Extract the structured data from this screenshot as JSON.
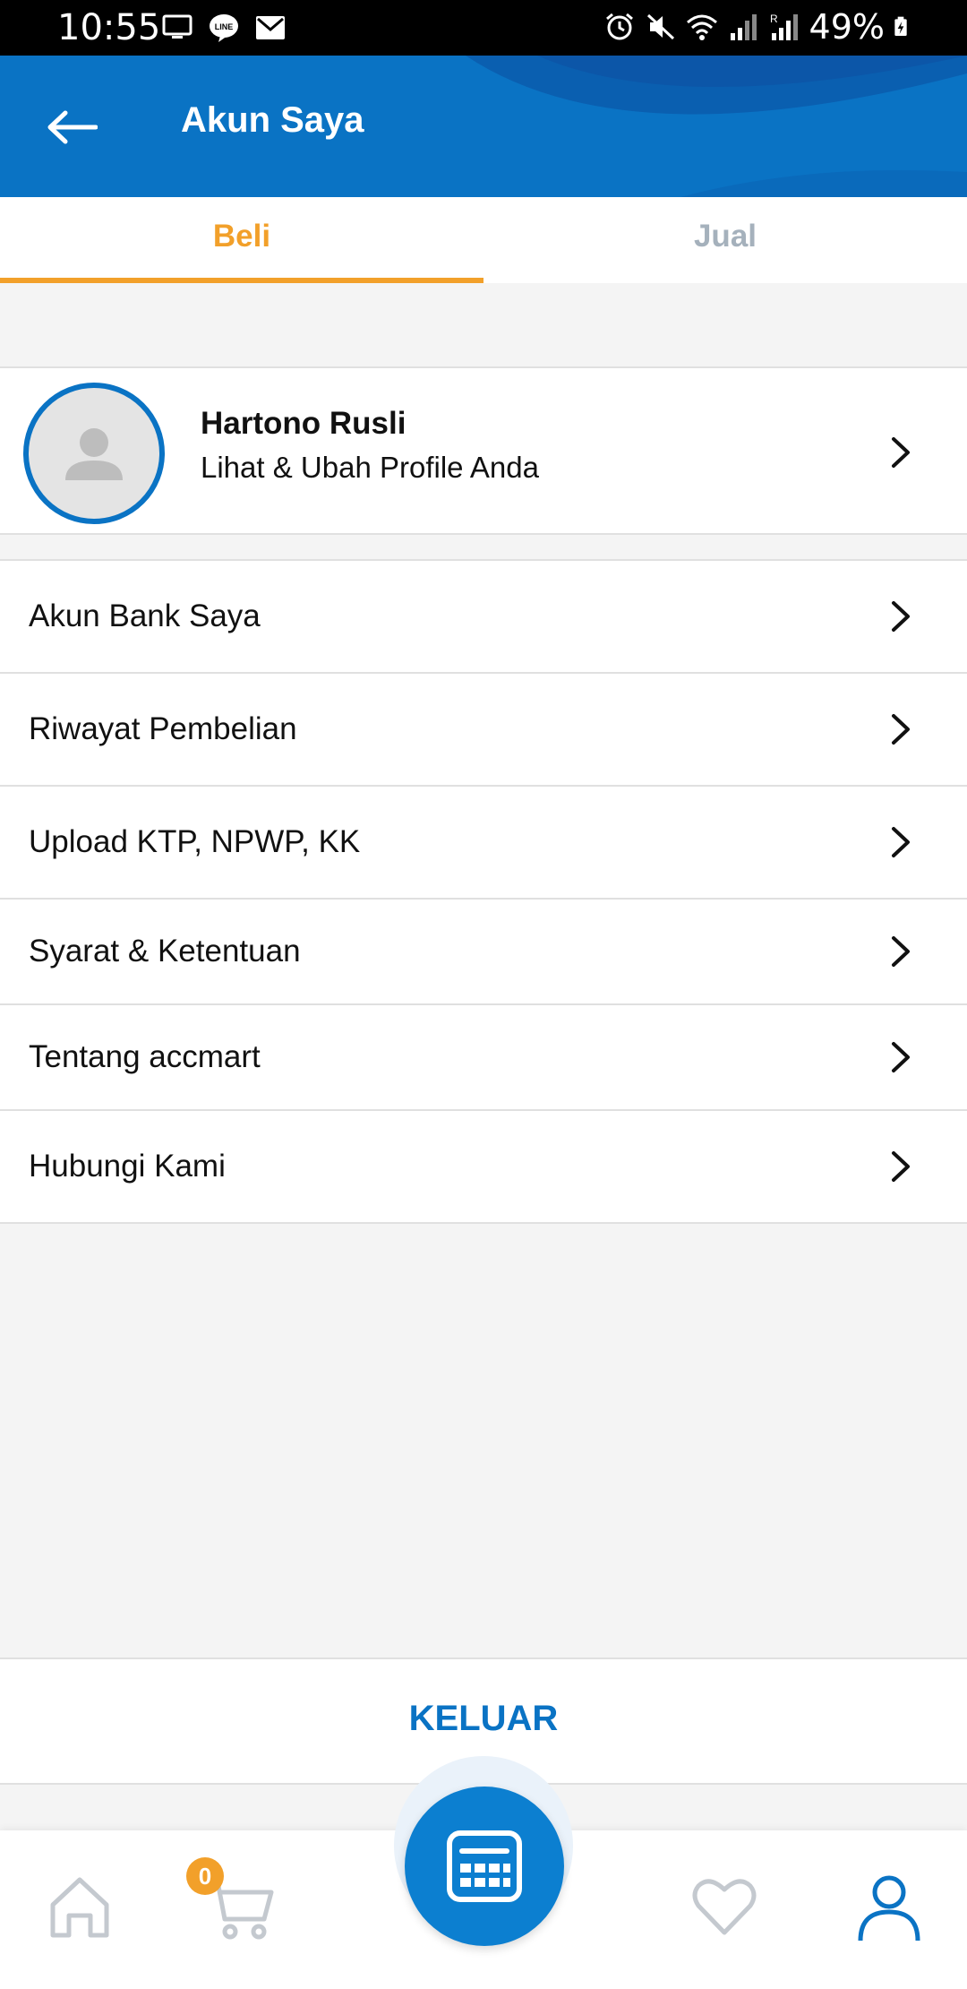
{
  "status_bar": {
    "time": "10:55",
    "battery": "49%",
    "left_icons": [
      "screen-icon",
      "line-icon",
      "mail-icon"
    ],
    "right_icons": [
      "alarm-icon",
      "mute-icon",
      "wifi-icon",
      "signal-icon",
      "signal-roaming-icon",
      "battery-charging-icon"
    ]
  },
  "header": {
    "title": "Akun Saya",
    "back_icon": "arrow-left-icon",
    "color": "#0a73c4"
  },
  "tabs": [
    {
      "label": "Beli",
      "active": true
    },
    {
      "label": "Jual",
      "active": false
    }
  ],
  "profile": {
    "name": "Hartono Rusli",
    "subtitle": "Lihat & Ubah Profile Anda"
  },
  "menu": [
    {
      "label": "Akun Bank Saya"
    },
    {
      "label": "Riwayat Pembelian"
    },
    {
      "label": "Upload KTP, NPWP, KK"
    },
    {
      "label": "Syarat & Ketentuan"
    },
    {
      "label": "Tentang accmart"
    },
    {
      "label": "Hubungi Kami"
    }
  ],
  "logout": {
    "label": "KELUAR"
  },
  "bottom_nav": {
    "cart_count": "0",
    "items": [
      "home-icon",
      "cart-icon",
      "calculator-icon",
      "heart-icon",
      "user-icon"
    ]
  },
  "colors": {
    "accent": "#f2a02a",
    "primary": "#0a73c4",
    "inactive_tab": "#a5b1bc"
  }
}
